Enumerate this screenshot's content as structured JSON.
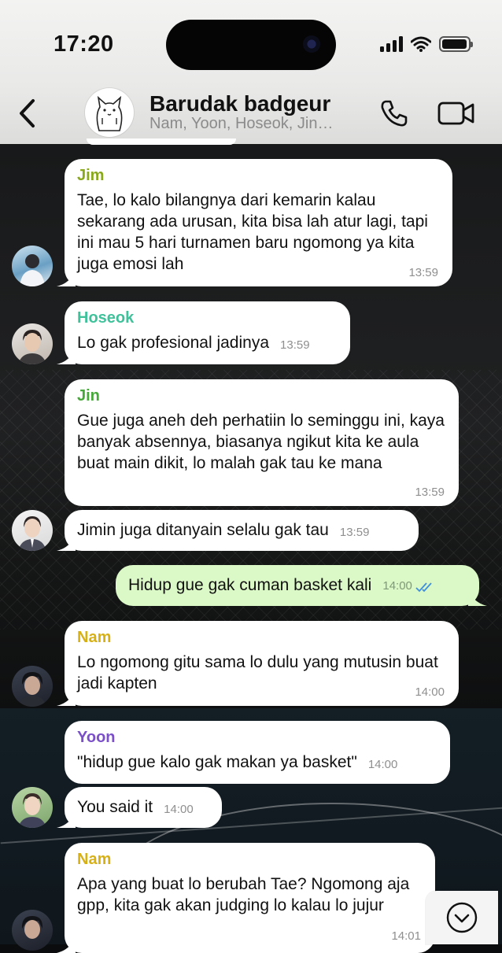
{
  "status_bar": {
    "time": "17:20"
  },
  "header": {
    "back_icon": "chevron-left-icon",
    "title": "Barudak badgeur",
    "subtitle": "Nam, Yoon, Hoseok, Jin…",
    "call_icon": "phone-icon",
    "video_icon": "video-camera-icon"
  },
  "colors": {
    "jim": "#8aa81c",
    "hoseok": "#3fc29a",
    "jin": "#47a83a",
    "nam": "#d7b015",
    "yoon": "#7a4fc9",
    "outgoing_bubble": "#dbf8c7",
    "read_ticks": "#3f8fe0"
  },
  "messages": [
    {
      "sender": "Jim",
      "text": "Tae, lo kalo bilangnya dari kemarin kalau sekarang ada urusan, kita bisa lah atur lagi, tapi ini mau 5 hari turnamen baru ngomong ya kita juga emosi lah",
      "time": "13:59"
    },
    {
      "sender": "Hoseok",
      "text": "Lo gak profesional jadinya",
      "time": "13:59"
    },
    {
      "sender": "Jin",
      "text": "Gue juga aneh deh perhatiin lo seminggu ini, kaya banyak absennya, biasanya ngikut kita ke aula buat main dikit, lo malah gak tau ke mana",
      "time": "13:59"
    },
    {
      "sender": "",
      "text": "Jimin juga ditanyain selalu gak tau",
      "time": "13:59"
    },
    {
      "sender": "me",
      "text": "Hidup gue gak cuman basket kali",
      "time": "14:00"
    },
    {
      "sender": "Nam",
      "text": "Lo ngomong gitu sama lo dulu yang mutusin buat jadi kapten",
      "time": "14:00"
    },
    {
      "sender": "Yoon",
      "text": "\"hidup gue kalo gak makan ya basket\"",
      "time": "14:00"
    },
    {
      "sender": "",
      "text": "You said it",
      "time": "14:00"
    },
    {
      "sender": "Nam",
      "text": "Apa yang buat lo berubah Tae? Ngomong aja gpp, kita gak akan judging lo kalau lo jujur",
      "time": "14:01"
    }
  ],
  "scroll_down_icon": "chevron-down-circle-icon"
}
